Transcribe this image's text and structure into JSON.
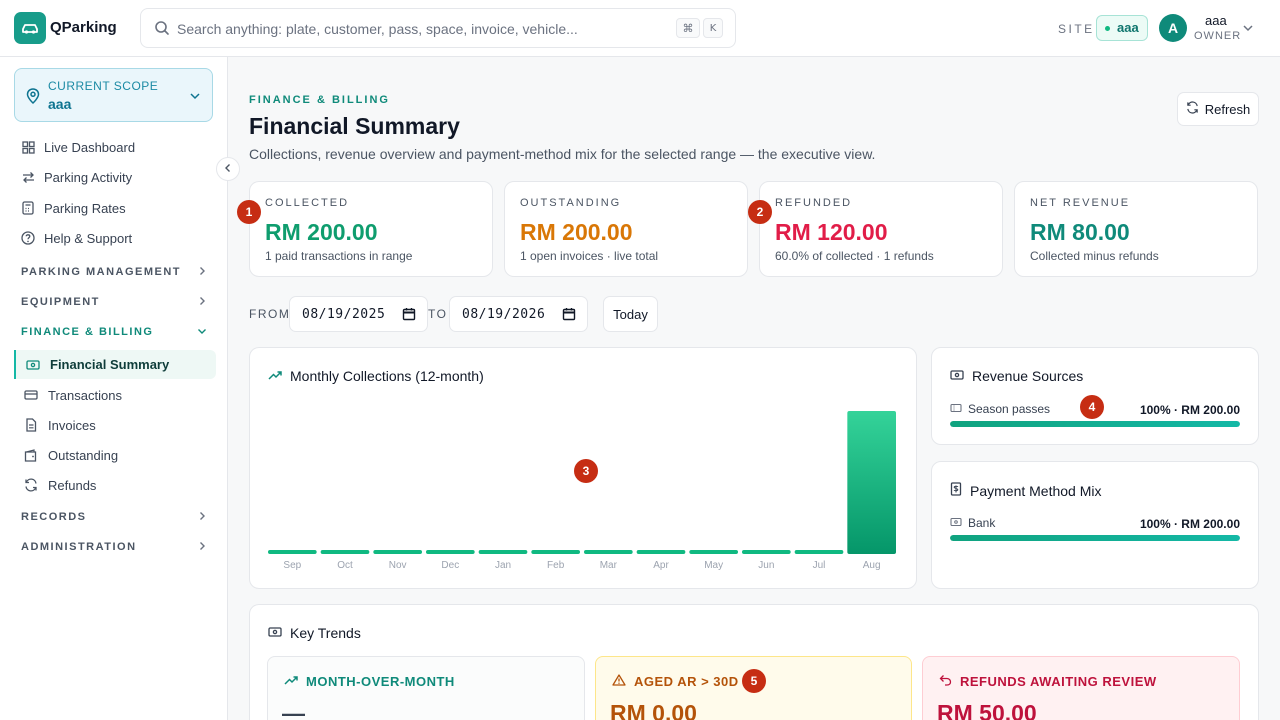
{
  "app": {
    "brand": "QParking"
  },
  "search": {
    "placeholder": "Search anything: plate, customer, pass, space, invoice, vehicle...",
    "kbd_cmd": "⌘",
    "kbd_key": "K"
  },
  "header": {
    "site_label": "SITE",
    "site_value": "aaa",
    "avatar_initial": "A",
    "user_name": "aaa",
    "user_role": "OWNER"
  },
  "sidebar": {
    "scope_label": "CURRENT SCOPE",
    "scope_value": "aaa",
    "top_items": [
      {
        "label": "Live Dashboard",
        "icon": "grid-icon"
      },
      {
        "label": "Parking Activity",
        "icon": "arrows-icon"
      },
      {
        "label": "Parking Rates",
        "icon": "calculator-icon"
      },
      {
        "label": "Help & Support",
        "icon": "help-icon"
      }
    ],
    "groups": {
      "parking_management": "PARKING MANAGEMENT",
      "equipment": "EQUIPMENT",
      "finance_billing": "FINANCE & BILLING",
      "records": "RECORDS",
      "administration": "ADMINISTRATION"
    },
    "finance_items": [
      {
        "label": "Financial Summary",
        "icon": "money-icon",
        "active": true
      },
      {
        "label": "Transactions",
        "icon": "card-icon"
      },
      {
        "label": "Invoices",
        "icon": "document-icon"
      },
      {
        "label": "Outstanding",
        "icon": "wallet-icon"
      },
      {
        "label": "Refunds",
        "icon": "refresh-icon"
      }
    ]
  },
  "page": {
    "eyebrow": "FINANCE & BILLING",
    "title": "Financial Summary",
    "subtitle": "Collections, revenue overview and payment-method mix for the selected range — the executive view.",
    "refresh_label": "Refresh"
  },
  "kpis": [
    {
      "label": "COLLECTED",
      "value": "RM 200.00",
      "note": "1 paid transactions in range",
      "color": "#0f9d6e"
    },
    {
      "label": "OUTSTANDING",
      "value": "RM 200.00",
      "note": "1 open invoices · live total",
      "color": "#d97706"
    },
    {
      "label": "REFUNDED",
      "value": "RM 120.00",
      "note": "60.0% of collected · 1 refunds",
      "color": "#e11d48"
    },
    {
      "label": "NET REVENUE",
      "value": "RM 80.00",
      "note": "Collected minus refunds",
      "color": "#0f8a7a"
    }
  ],
  "range": {
    "from_label": "FROM",
    "from_value": "08/19/2025",
    "to_label": "TO",
    "to_value": "08/19/2026",
    "today_label": "Today"
  },
  "monthly": {
    "title": "Monthly Collections (12-month)"
  },
  "chart_data": {
    "type": "bar",
    "title": "Monthly Collections (12-month)",
    "categories": [
      "Sep",
      "Oct",
      "Nov",
      "Dec",
      "Jan",
      "Feb",
      "Mar",
      "Apr",
      "May",
      "Jun",
      "Jul",
      "Aug"
    ],
    "values": [
      0,
      0,
      0,
      0,
      0,
      0,
      0,
      0,
      0,
      0,
      0,
      200
    ],
    "ylim": [
      0,
      200
    ],
    "grid": false,
    "bar_color": "#10b981"
  },
  "revenue_sources": {
    "title": "Revenue Sources",
    "rows": [
      {
        "label": "Season passes",
        "value": "100% · RM 200.00",
        "pct": 100
      }
    ]
  },
  "payment_mix": {
    "title": "Payment Method Mix",
    "rows": [
      {
        "label": "Bank",
        "value": "100% · RM 200.00",
        "pct": 100
      }
    ]
  },
  "key_trends": {
    "title": "Key Trends",
    "cards": [
      {
        "label": "MONTH-OVER-MONTH",
        "value": "—",
        "color": "#0f8a7a"
      },
      {
        "label": "AGED AR > 30D",
        "value": "RM 0.00",
        "color": "#b45309"
      },
      {
        "label": "REFUNDS AWAITING REVIEW",
        "value": "RM 50.00",
        "color": "#be123c"
      }
    ]
  },
  "markers": [
    "1",
    "2",
    "3",
    "4",
    "5"
  ]
}
